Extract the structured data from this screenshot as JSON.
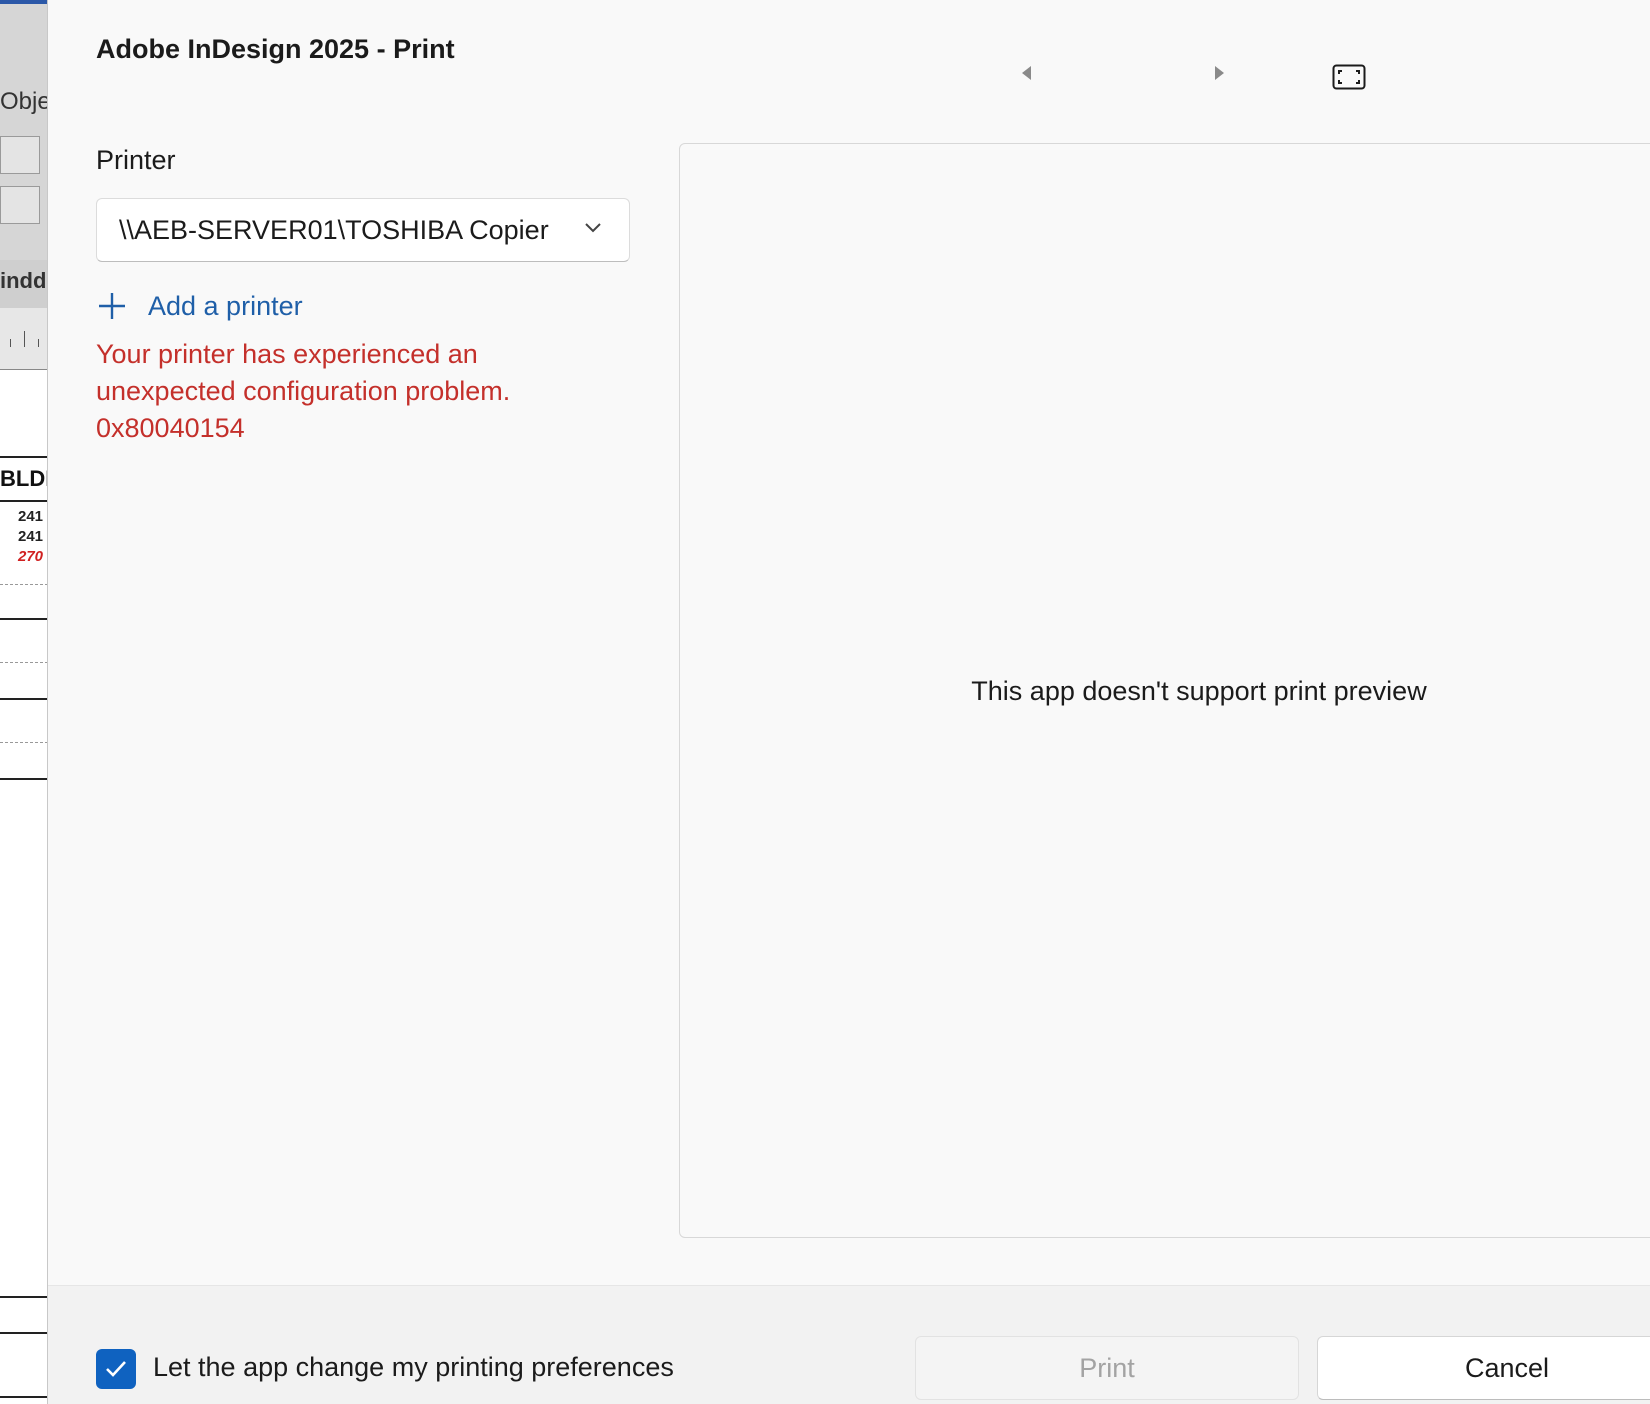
{
  "background_app": {
    "menu_fragment": "Obje",
    "tab_fragment": "indd",
    "heading_fragment": "BLDI",
    "row_fragments": [
      "241",
      "241",
      "270"
    ]
  },
  "dialog": {
    "title": "Adobe InDesign 2025 - Print",
    "nav": {
      "prev_icon": "triangle-left-icon",
      "next_icon": "triangle-right-icon",
      "fit_icon": "fit-page-icon"
    },
    "printer": {
      "label": "Printer",
      "selected": "\\\\AEB-SERVER01\\TOSHIBA Copier"
    },
    "add_printer_label": "Add a printer",
    "error": {
      "line1": "Your printer has experienced an",
      "line2": "unexpected configuration problem.",
      "code": "0x80040154",
      "color": "#c4302b"
    },
    "preview": {
      "message": "This app doesn't support print preview"
    },
    "footer": {
      "checkbox_label": "Let the app change my printing preferences",
      "checkbox_checked": true,
      "print_label": "Print",
      "print_enabled": false,
      "cancel_label": "Cancel"
    },
    "colors": {
      "accent": "#0f62c0",
      "link": "#1f5fa8"
    }
  }
}
